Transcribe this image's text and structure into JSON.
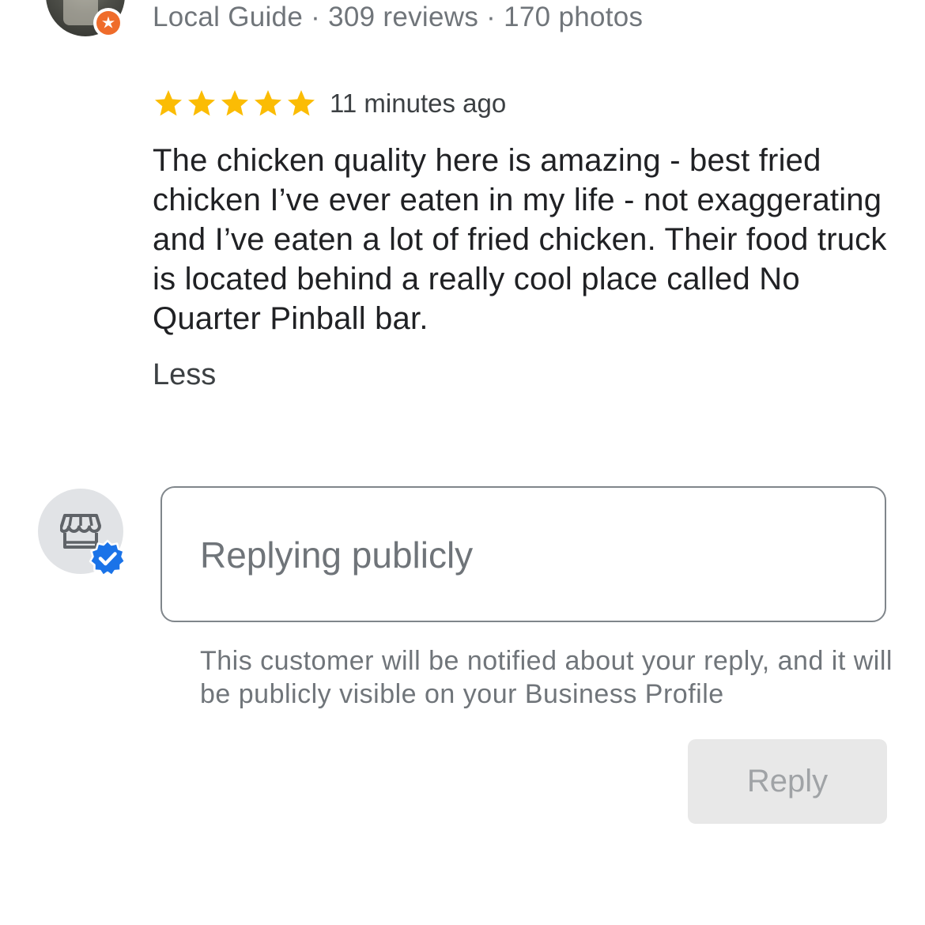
{
  "reviewer": {
    "meta": "Local Guide · 309 reviews · 170 photos",
    "badge_icon": "local-guide-star-badge"
  },
  "review": {
    "rating": 5,
    "rating_max": 5,
    "star_color": "#fbbc04",
    "time": "11 minutes ago",
    "text": "The chicken quality here is amazing - best fried chicken I’ve ever eaten in my life - not exaggerating and I’ve eaten a lot of fried chicken. Their food truck is located behind a really cool place called No Quarter Pinball bar.",
    "less_label": "Less"
  },
  "reply": {
    "avatar_icon": "storefront-icon",
    "verified_icon": "verified-check-icon",
    "verified_color": "#1a73e8",
    "placeholder": "Replying publicly",
    "value": "",
    "notice": "This customer will be notified about your reply, and it will be publicly visible on your Business Profile",
    "button_label": "Reply",
    "button_enabled": false
  }
}
